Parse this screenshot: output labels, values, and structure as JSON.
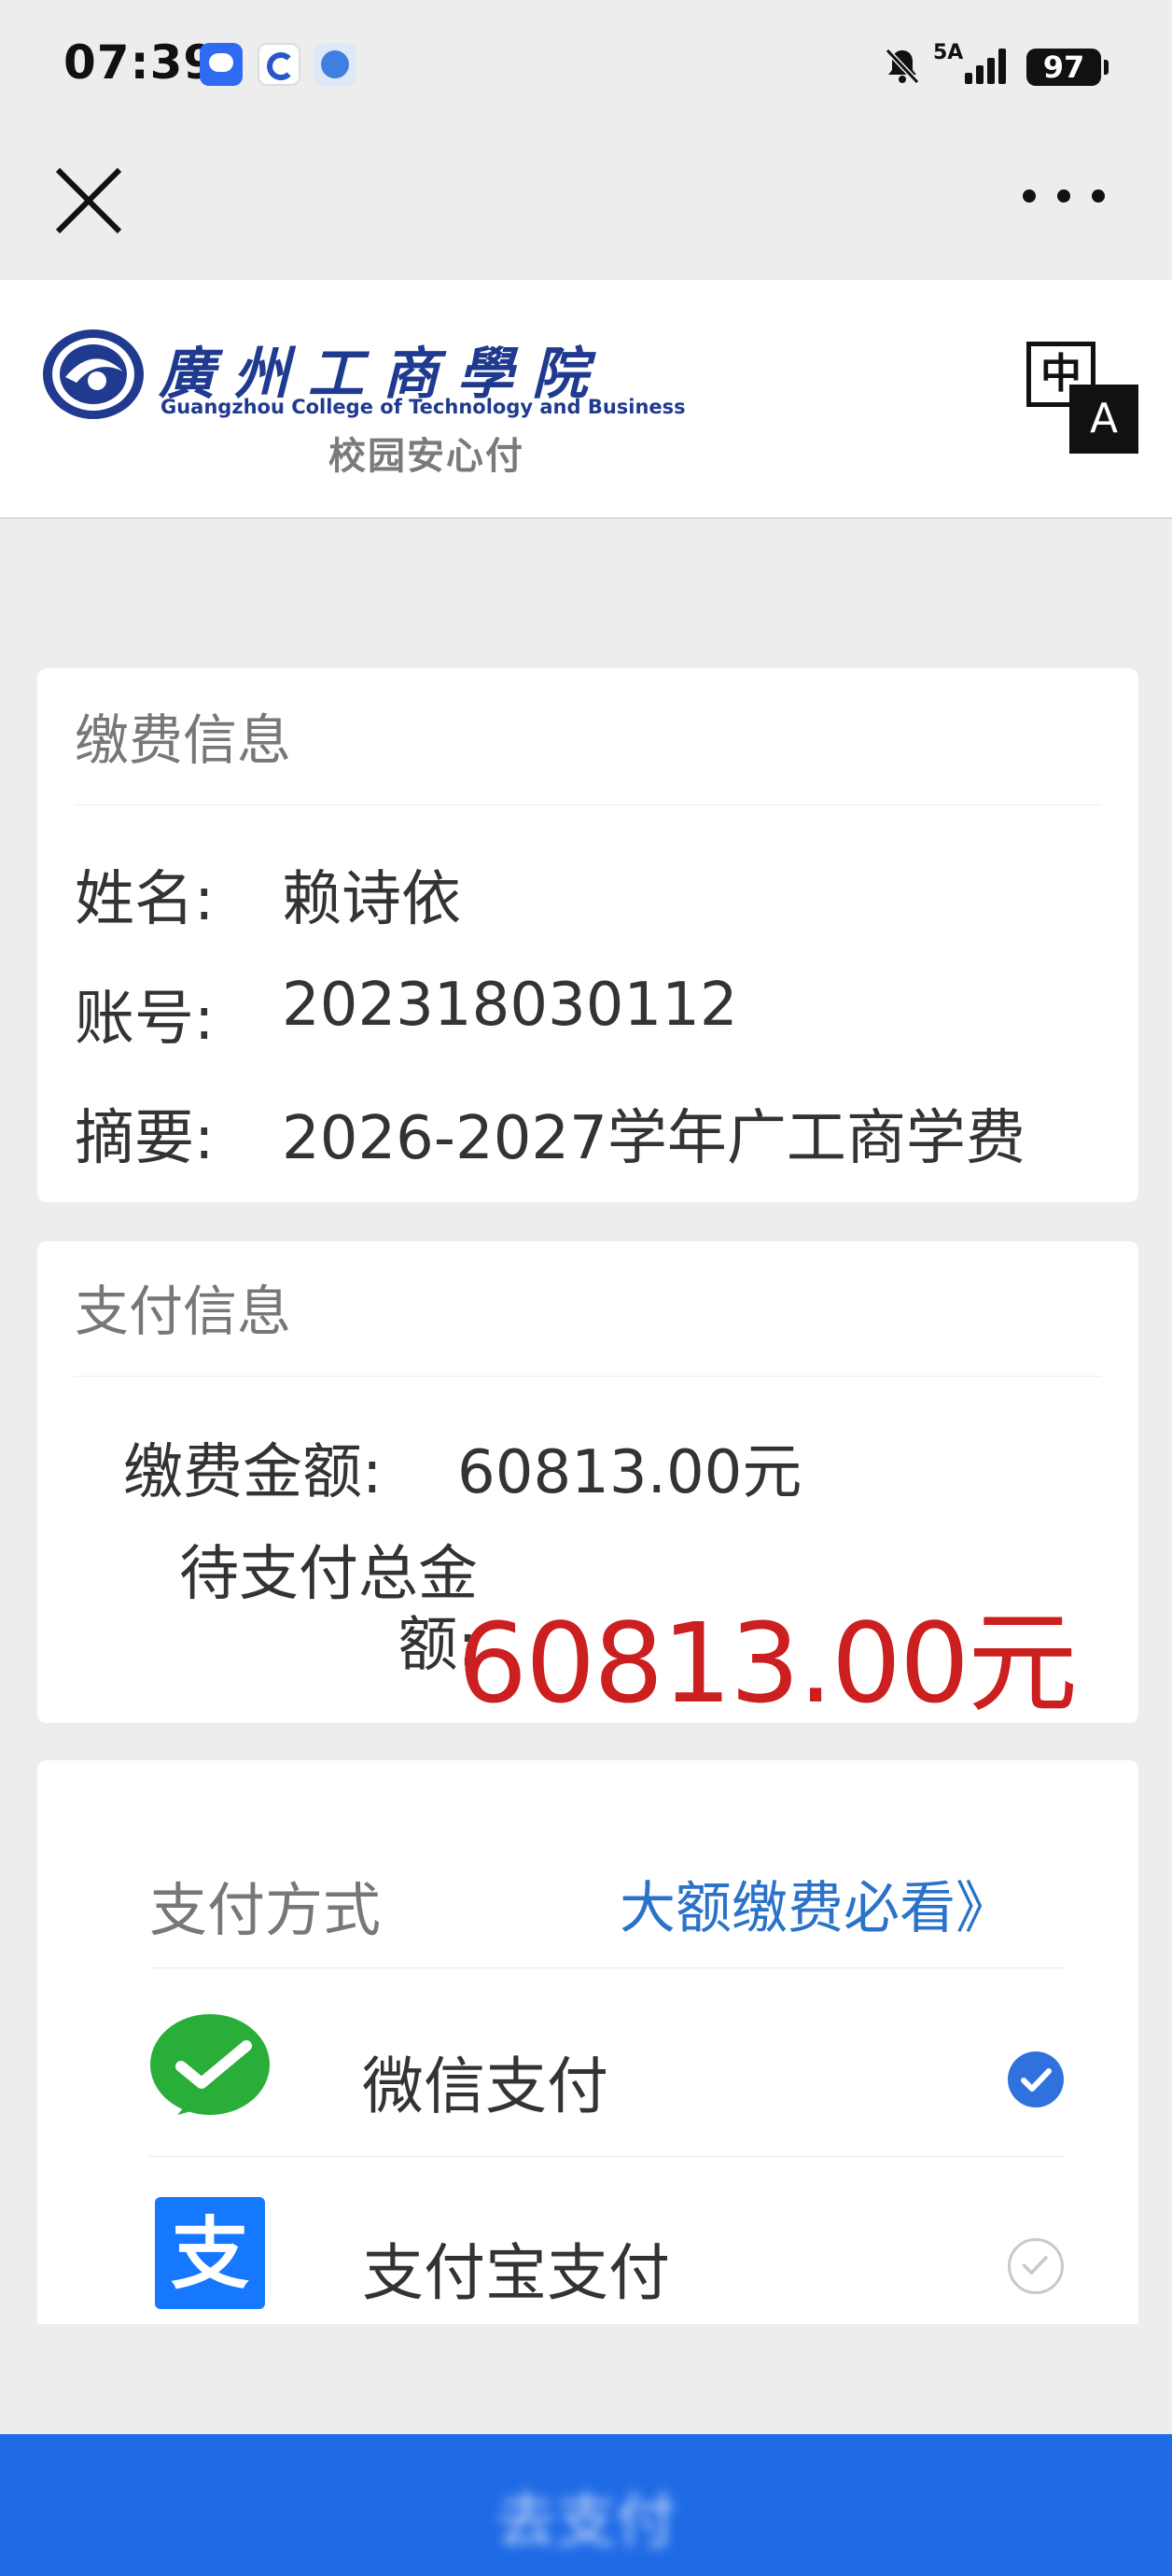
{
  "status_bar": {
    "time": "07:39",
    "network": "5A",
    "battery": "97"
  },
  "header": {
    "school_name_cn": "廣州工商學院",
    "school_name_en": "Guangzhou College of Technology and Business",
    "subtitle": "校园安心付",
    "translate_cn": "中",
    "translate_en": "A"
  },
  "fee_info": {
    "title": "缴费信息",
    "rows": [
      {
        "label": "姓名:",
        "value": "赖诗依"
      },
      {
        "label": "账号:",
        "value": "202318030112"
      },
      {
        "label": "摘要:",
        "value": "2026-2027学年广工商学费"
      }
    ]
  },
  "payment_info": {
    "title": "支付信息",
    "amount_label": "缴费金额:",
    "amount_value": "60813.00元",
    "total_label": "待支付总金额:",
    "total_value": "60813.00元"
  },
  "payment_method": {
    "title": "支付方式",
    "link": "大额缴费必看》",
    "options": [
      {
        "label": "微信支付",
        "selected": true,
        "icon": "wechat-pay-icon"
      },
      {
        "label": "支付宝支付",
        "selected": false,
        "icon": "alipay-icon"
      }
    ]
  },
  "pay_button": {
    "label": "去支付"
  },
  "colors": {
    "accent": "#1f6be6",
    "amount_red": "#cc1f1f",
    "link_blue": "#2a73c8",
    "wechat_green": "#2aae3a",
    "alipay_blue": "#1677ff"
  }
}
